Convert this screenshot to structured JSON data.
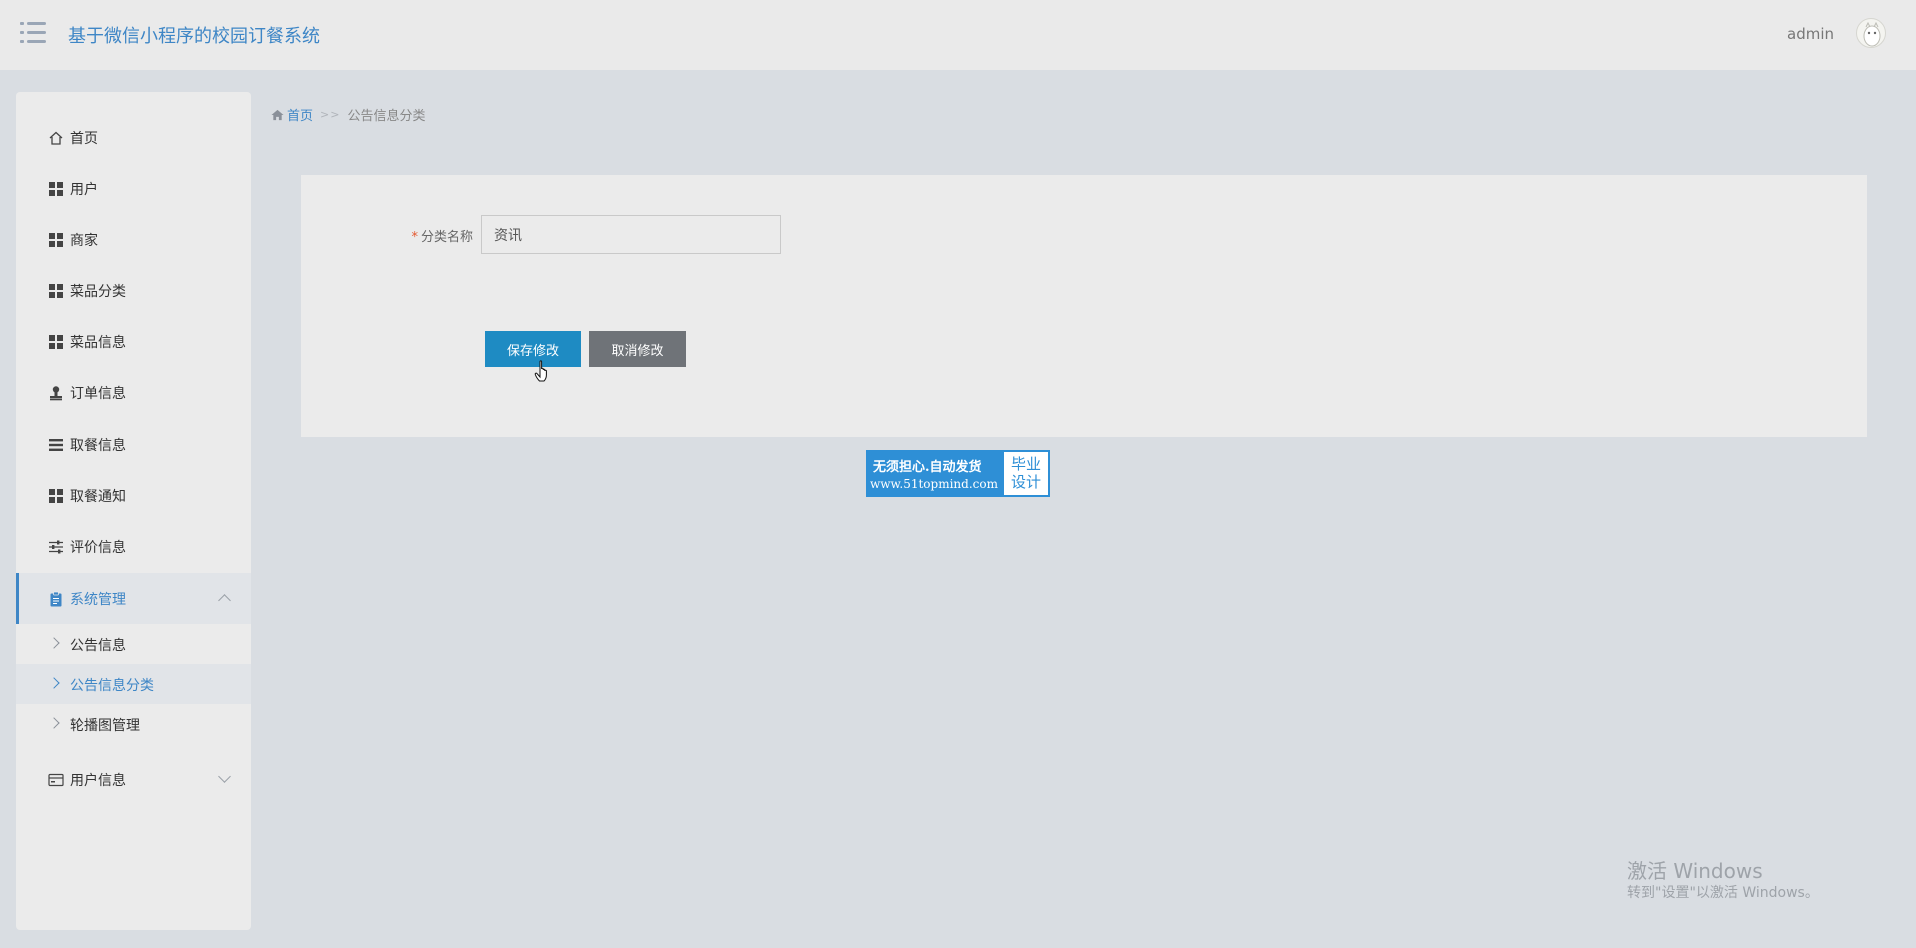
{
  "header": {
    "title": "基于微信小程序的校园订餐系统",
    "user_name": "admin"
  },
  "sidebar": {
    "items": [
      {
        "label": "首页",
        "icon": "home-icon"
      },
      {
        "label": "用户",
        "icon": "grid-icon"
      },
      {
        "label": "商家",
        "icon": "grid-icon"
      },
      {
        "label": "菜品分类",
        "icon": "grid-icon"
      },
      {
        "label": "菜品信息",
        "icon": "grid-icon"
      },
      {
        "label": "订单信息",
        "icon": "stamp-icon"
      },
      {
        "label": "取餐信息",
        "icon": "list-icon"
      },
      {
        "label": "取餐通知",
        "icon": "grid-icon"
      },
      {
        "label": "评价信息",
        "icon": "sliders-icon"
      },
      {
        "label": "系统管理",
        "icon": "clipboard-icon",
        "expanded": true
      },
      {
        "label": "用户信息",
        "icon": "card-icon",
        "expanded": false
      }
    ],
    "sub_items": [
      {
        "label": "公告信息"
      },
      {
        "label": "公告信息分类",
        "selected": true
      },
      {
        "label": "轮播图管理"
      }
    ]
  },
  "breadcrumb": {
    "home": "首页",
    "separator": ">>",
    "current": "公告信息分类"
  },
  "form": {
    "required_mark": "*",
    "category_label": "分类名称",
    "category_value": "资讯",
    "save_label": "保存修改",
    "cancel_label": "取消修改"
  },
  "ad": {
    "line1": "无须担心.自动发货",
    "line2": "www.51topmind.com",
    "right_line1": "毕业",
    "right_line2": "设计"
  },
  "watermark": {
    "line1": "激活 Windows",
    "line2": "转到\"设置\"以激活 Windows。"
  },
  "colors": {
    "accent": "#3e86c6",
    "save_button": "#1e8bc3",
    "cancel_button": "#6f7378",
    "background": "#d9dde2"
  }
}
